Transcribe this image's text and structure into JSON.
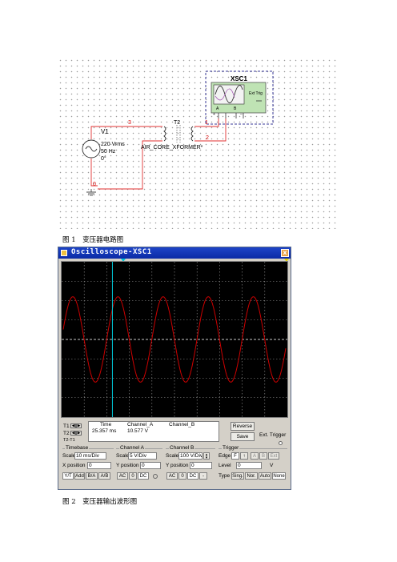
{
  "schematic": {
    "scope_name": "XSC1",
    "ext_trig_label": "Ext Trig",
    "scope_terminals": {
      "a": "A",
      "b": "B",
      "plus": "+",
      "minus": "_"
    },
    "source_name": "V1",
    "source_voltage": "220 Vrms",
    "source_freq": "50 Hz",
    "source_phase": "0°",
    "transformer_name": "T2",
    "transformer_model": "AIR_CORE_XFORMER*",
    "node_labels": {
      "n3": "3",
      "n1": "1",
      "n2": "2",
      "n0": "0"
    }
  },
  "captions": {
    "fig1": "图 1　变压器电路图",
    "fig2": "图 2　变压器输出波形图"
  },
  "window": {
    "title": "Oscilloscope-XSC1",
    "close_glyph": "x"
  },
  "waveform": {
    "color": "#cc0000",
    "cursor_color": "#00c8d8",
    "cycles_visible": 5,
    "amplitude_divs": 2.2,
    "cursor_t1_div": 2.25
  },
  "readout": {
    "t1_label": "T1",
    "t2_label": "T2",
    "t2t1_label": "T2-T1",
    "col_time": "Time",
    "col_cha": "Channel_A",
    "col_chb": "Channel_B",
    "time_value": "25.357 ms",
    "cha_value": "10.577 V",
    "reverse_label": "Reverse",
    "save_label": "Save",
    "ext_trigger_label": "Ext. Trigger"
  },
  "timebase": {
    "group_label": "Timebase",
    "scale_label": "Scale",
    "scale_value": "10 ms/Div",
    "xpos_label": "X position",
    "xpos_value": "0",
    "buttons": [
      "Y/T",
      "Add",
      "B/A",
      "A/B"
    ]
  },
  "channel_a": {
    "group_label": "Channel A",
    "scale_label": "Scale",
    "scale_value": "5 V/Div",
    "ypos_label": "Y position",
    "ypos_value": "0",
    "buttons": [
      "AC",
      "0",
      "DC"
    ]
  },
  "channel_b": {
    "group_label": "Channel B",
    "scale_label": "Scale",
    "scale_value": "100 V/Div",
    "ypos_label": "Y position",
    "ypos_value": "0",
    "buttons": [
      "AC",
      "0",
      "DC",
      "-"
    ]
  },
  "trigger": {
    "group_label": "Trigger",
    "edge_label": "Edge",
    "level_label": "Level",
    "level_value": "0",
    "level_unit": "V",
    "type_label": "Type",
    "type_buttons": [
      "Sing.",
      "Nor.",
      "Auto",
      "None"
    ],
    "edge_buttons": [
      "F",
      "↑",
      "A",
      "B",
      "Ext"
    ]
  }
}
